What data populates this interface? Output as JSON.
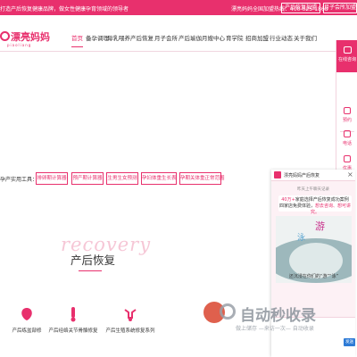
{
  "topbar": {
    "notice": "打造产后恢复健康品牌，做女性健康孕育领域的领导者",
    "hotline": "漂亮妈妈全国加盟热线：400-025-1868",
    "franchise_button": "产后恢复加盟",
    "yuesao_button": "月子会所加盟"
  },
  "logo": {
    "name": "漂亮妈妈",
    "sub": "piaoliang"
  },
  "nav": {
    "items": [
      "首页",
      "备孕调理",
      "母乳喂养",
      "产后恢复",
      "月子会所",
      "产后瑜伽",
      "月嫂中心",
      "育学院",
      "招商加盟",
      "行业动态",
      "关于我们"
    ]
  },
  "sidebar": {
    "online_label": "在线咨询",
    "items": [
      "预约",
      "电话",
      "优惠"
    ]
  },
  "tools": {
    "label": "孕产实用工具：",
    "items": [
      "排卵期计算器",
      "预产期计算器",
      "生男生女预测",
      "孕妇体重生长表",
      "孕期关体重正常范围"
    ]
  },
  "section": {
    "ghost": "recovery",
    "title": "产后恢复"
  },
  "cards": [
    "产后练盆部修",
    "产后经络关节骨骼修复",
    "产后生殖系统修复系列"
  ],
  "popup": {
    "title": "漂亮妈妈产后恢复",
    "close": "×",
    "time": "昨天上午聊天记录",
    "msg_line1_red": "40万+",
    "msg_line1": "家庭选择产后恢复成功案例",
    "msg_line2_prefix": "四家店免费体验，",
    "msg_line2_pink": "想去咨询、想可讲究。",
    "img_char1": "游",
    "img_char2": "泳",
    "img_caption": "还沉浸在你们的“游”“泳”",
    "send": "发送"
  },
  "watermark": {
    "big": "自动秒收录",
    "small": "做上储存 —来访一次— 自动收录"
  },
  "colors": {
    "accent": "#e8306d",
    "send_blue": "#2e7bd6"
  }
}
